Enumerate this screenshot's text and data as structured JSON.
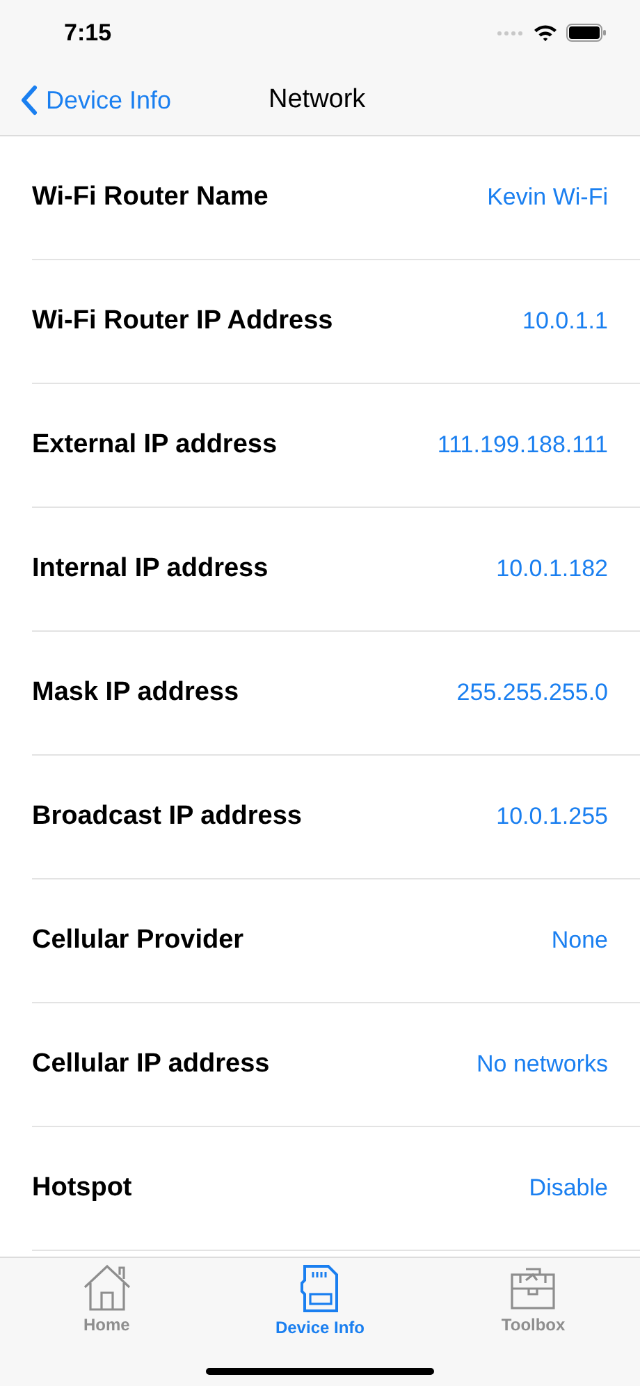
{
  "status_bar": {
    "time": "7:15"
  },
  "nav": {
    "back": "Device Info",
    "title": "Network"
  },
  "rows": [
    {
      "label": "Wi-Fi Router Name",
      "value": "Kevin Wi-Fi"
    },
    {
      "label": "Wi-Fi Router IP Address",
      "value": "10.0.1.1"
    },
    {
      "label": "External IP address",
      "value": "111.199.188.111"
    },
    {
      "label": "Internal IP address",
      "value": "10.0.1.182"
    },
    {
      "label": "Mask IP address",
      "value": "255.255.255.0"
    },
    {
      "label": "Broadcast IP address",
      "value": "10.0.1.255"
    },
    {
      "label": "Cellular Provider",
      "value": "None"
    },
    {
      "label": "Cellular IP address",
      "value": "No networks"
    },
    {
      "label": "Hotspot",
      "value": "Disable"
    }
  ],
  "tabs": [
    {
      "kind": "home",
      "label": "Home",
      "selected": false
    },
    {
      "kind": "card",
      "label": "Device Info",
      "selected": true
    },
    {
      "kind": "toolbox",
      "label": "Toolbox",
      "selected": false
    }
  ]
}
